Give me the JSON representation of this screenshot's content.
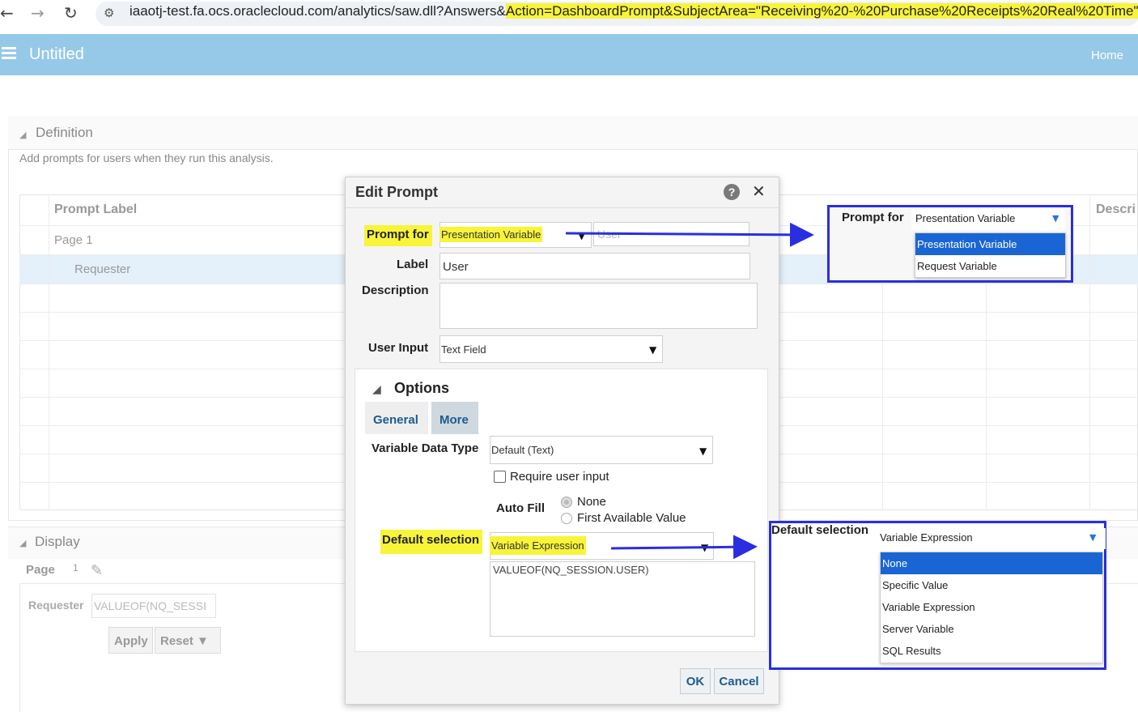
{
  "browser": {
    "url_prefix": "iaaotj-test.fa.ocs.oraclecloud.com/analytics/saw.dll?Answers&",
    "url_highlight": "Action=DashboardPrompt&SubjectArea=\"Receiving%20-%20Purchase%20Receipts%20Real%20Time\"",
    "back_icon": "←",
    "forward_icon": "→",
    "reload_icon": "↻",
    "site_icon": "⚙"
  },
  "header": {
    "title": "Untitled",
    "home": "Home"
  },
  "definition": {
    "title": "Definition",
    "description": "Add prompts for users when they run this analysis.",
    "col_prompt_label": "Prompt Label",
    "col_description": "Descri",
    "row_page": "Page 1",
    "row_requester": "Requester"
  },
  "display": {
    "title": "Display",
    "page_label": "Page",
    "page_number": "1",
    "requester_label": "Requester",
    "requester_value": "VALUEOF(NQ_SESSI",
    "apply": "Apply",
    "reset": "Reset ▼"
  },
  "dialog": {
    "title": "Edit Prompt",
    "help": "?",
    "close": "✕",
    "prompt_for_label": "Prompt for",
    "prompt_for_value": "Presentation Variable",
    "prompt_for_name": "User",
    "label_label": "Label",
    "label_value": "User",
    "description_label": "Description",
    "user_input_label": "User Input",
    "user_input_value": "Text Field",
    "options_title": "Options",
    "tab_general": "General",
    "tab_more": "More",
    "variable_data_type_label": "Variable Data Type",
    "variable_data_type_value": "Default (Text)",
    "require_user_input_label": "Require user input",
    "auto_fill_label": "Auto Fill",
    "auto_fill_options": [
      "None",
      "First Available Value"
    ],
    "default_selection_label": "Default selection",
    "default_selection_value": "Variable Expression",
    "expression_value": "VALUEOF(NQ_SESSION.USER)",
    "ok": "OK",
    "cancel": "Cancel"
  },
  "callout_prompt_for": {
    "label": "Prompt for",
    "selected": "Presentation Variable",
    "options": [
      "Presentation Variable",
      "Request Variable"
    ]
  },
  "callout_default_selection": {
    "label": "Default selection",
    "selected": "Variable Expression",
    "options": [
      "None",
      "Specific Value",
      "Variable Expression",
      "Server Variable",
      "SQL Results"
    ]
  },
  "colors": {
    "header": "#96c9e8",
    "highlight": "#f7f43a",
    "callout_border": "#2b2ee0",
    "arrow": "#2b2ee0",
    "selected_option": "#1a65d4"
  }
}
